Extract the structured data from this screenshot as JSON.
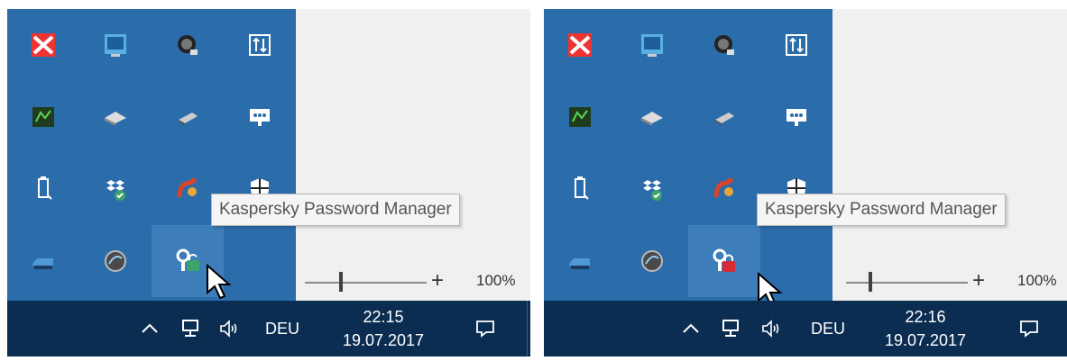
{
  "panels": [
    {
      "tray_icons": [
        [
          "kaspersky-icon",
          "network-monitor-icon",
          "satellite-dish-icon",
          "transfer-icon"
        ],
        [
          "green-board-icon",
          "scanner-icon",
          "usb-device-icon",
          "chat-screen-icon"
        ],
        [
          "usb-drive-icon",
          "dropbox-sync-icon",
          "cleanup-tool-icon",
          "shield-icon"
        ],
        [
          "printer-icon",
          "globe-app-icon",
          "password-manager-unlocked-icon",
          ""
        ]
      ],
      "tooltip": "Kaspersky Password Manager",
      "zoom": {
        "value_text": "100%",
        "plus": "+"
      },
      "taskbar": {
        "chevron": "^",
        "language": "DEU",
        "time": "22:15",
        "date": "19.07.2017"
      }
    },
    {
      "tray_icons": [
        [
          "kaspersky-icon",
          "network-monitor-icon",
          "satellite-dish-icon",
          "transfer-icon"
        ],
        [
          "green-board-icon",
          "scanner-icon",
          "usb-device-icon",
          "chat-screen-icon"
        ],
        [
          "usb-drive-icon",
          "dropbox-sync-icon",
          "cleanup-tool-icon",
          "shield-icon"
        ],
        [
          "printer-icon",
          "globe-app-icon",
          "password-manager-locked-icon",
          ""
        ]
      ],
      "tooltip": "Kaspersky Password Manager",
      "zoom": {
        "value_text": "100%",
        "plus": "+"
      },
      "taskbar": {
        "chevron": "^",
        "language": "DEU",
        "time": "22:16",
        "date": "19.07.2017"
      }
    }
  ],
  "colors": {
    "overflow_bg": "#2b6cab",
    "taskbar_bg": "#0c2d52",
    "unlocked_badge": "#3aa46a",
    "locked_badge": "#d62b35"
  }
}
